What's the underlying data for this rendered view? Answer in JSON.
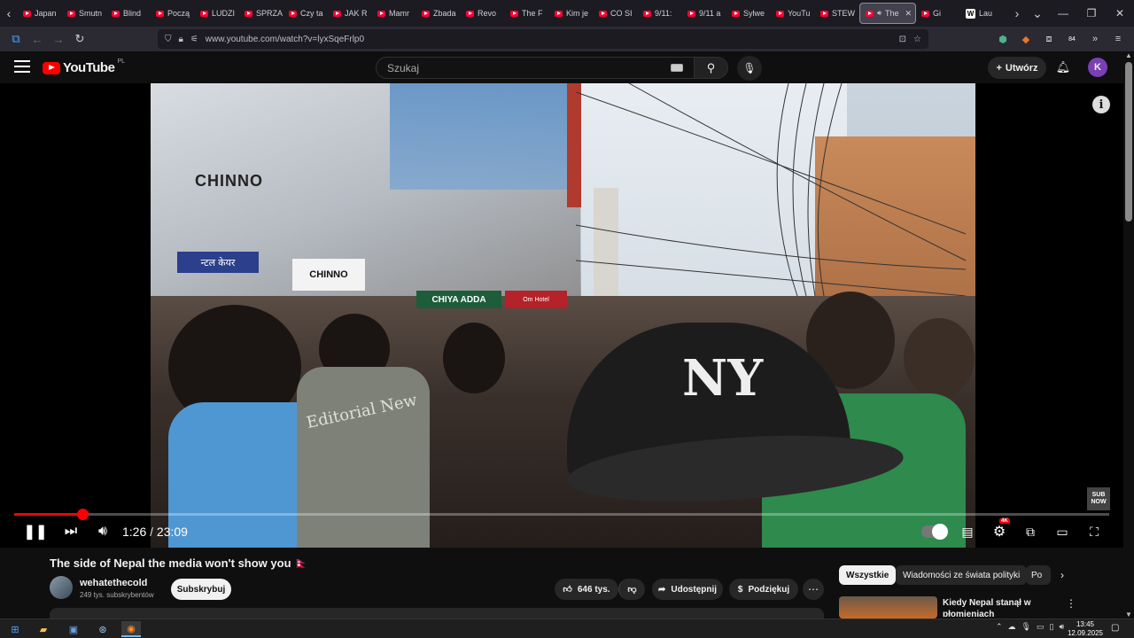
{
  "browser": {
    "tabs": [
      {
        "label": "Japan"
      },
      {
        "label": "Smutn"
      },
      {
        "label": "Blind"
      },
      {
        "label": "Począ"
      },
      {
        "label": "LUDZI"
      },
      {
        "label": "SPRZA"
      },
      {
        "label": "Czy ta"
      },
      {
        "label": "JAK R"
      },
      {
        "label": "Mamr"
      },
      {
        "label": "Zbada"
      },
      {
        "label": "Revo"
      },
      {
        "label": "The F"
      },
      {
        "label": "Kim je"
      },
      {
        "label": "CO SI"
      },
      {
        "label": "9/11:"
      },
      {
        "label": "9/11 a"
      },
      {
        "label": "Sylwe"
      },
      {
        "label": "YouTu"
      },
      {
        "label": "STEW"
      }
    ],
    "active_tab": {
      "label": "The"
    },
    "after_tabs": [
      {
        "label": "Gi"
      },
      {
        "label": "Lau"
      }
    ],
    "url": "www.youtube.com/watch?v=lyxSqeFrlp0",
    "ext_badge": "84"
  },
  "youtube": {
    "logo_text": "YouTube",
    "region": "PL",
    "search_placeholder": "Szukaj",
    "create_label": "Utwórz",
    "avatar_letter": "K"
  },
  "player": {
    "current_time": "1:26",
    "separator": "/",
    "duration": "23:09",
    "progress_fraction": 0.062,
    "sub_now": "SUB NOW",
    "quality_badge": "4K",
    "scene": {
      "shop_sign": "CHINNO",
      "shop_sign_small": "CHINNO",
      "nepali_sign": "न्टल केयर",
      "cafe_sign": "CHIYA ADDA",
      "red_sign": "Om Hotel",
      "shirt_text": "Editorial New",
      "cap_text": "NY"
    }
  },
  "video": {
    "title": "The side of Nepal the media won't show you 🇳🇵",
    "channel": "wehatethecold",
    "subscribers": "249 tys. subskrybentów",
    "subscribe_label": "Subskrybuj",
    "likes": "646 tys.",
    "share_label": "Udostępnij",
    "thanks_label": "Podziękuj"
  },
  "sidebar": {
    "chips": [
      {
        "label": "Wszystkie"
      },
      {
        "label": "Wiadomości ze świata polityki"
      },
      {
        "label": "Po"
      }
    ],
    "recommendation": {
      "title": "Kiedy Nepal stanął w płomieniach"
    }
  },
  "taskbar": {
    "time": "13:45",
    "date": "12.09.2025"
  }
}
